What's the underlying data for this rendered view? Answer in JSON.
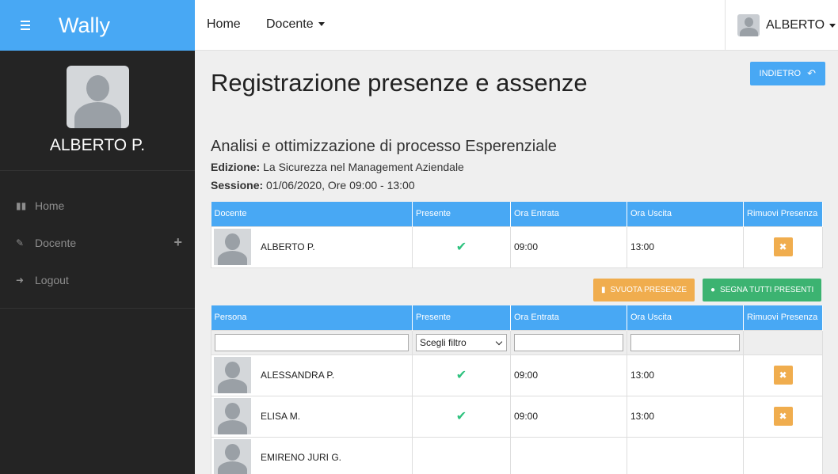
{
  "app": {
    "brand": "Wally"
  },
  "topnav": {
    "home": "Home",
    "docente": "Docente",
    "user": "ALBERTO"
  },
  "sidebar": {
    "profile_name": "ALBERTO P.",
    "items": [
      {
        "icon": "bar-chart-icon",
        "label": "Home"
      },
      {
        "icon": "edit-icon",
        "label": "Docente"
      },
      {
        "icon": "logout-icon",
        "label": "Logout"
      }
    ]
  },
  "page": {
    "title": "Registrazione presenze e assenze",
    "back_button": "INDIETRO",
    "subtitle": "Analisi e ottimizzazione di processo Esperenziale",
    "edizione_label": "Edizione:",
    "edizione_value": "La Sicurezza nel Management Aziendale",
    "sessione_label": "Sessione:",
    "sessione_value": "01/06/2020, Ore 09:00 - 13:00"
  },
  "docente_table": {
    "headers": [
      "Docente",
      "Presente",
      "Ora Entrata",
      "Ora Uscita",
      "Rimuovi Presenza"
    ],
    "rows": [
      {
        "name": "ALBERTO P.",
        "present": true,
        "entrata": "09:00",
        "uscita": "13:00"
      }
    ]
  },
  "actions": {
    "svuota": "SVUOTA PRESENZE",
    "segna": "SEGNA TUTTI PRESENTI"
  },
  "persone_table": {
    "headers": [
      "Persona",
      "Presente",
      "Ora Entrata",
      "Ora Uscita",
      "Rimuovi Presenza"
    ],
    "filter_select": "Scegli filtro",
    "rows": [
      {
        "name": "ALESSANDRA P.",
        "present": true,
        "entrata": "09:00",
        "uscita": "13:00"
      },
      {
        "name": "ELISA M.",
        "present": true,
        "entrata": "09:00",
        "uscita": "13:00"
      },
      {
        "name": "EMIRENO JURI G.",
        "present": false,
        "entrata": "",
        "uscita": ""
      }
    ]
  },
  "colors": {
    "accent": "#48a8f4",
    "warning": "#f0ad4e",
    "success": "#3cb371",
    "sidebar": "#242424"
  }
}
